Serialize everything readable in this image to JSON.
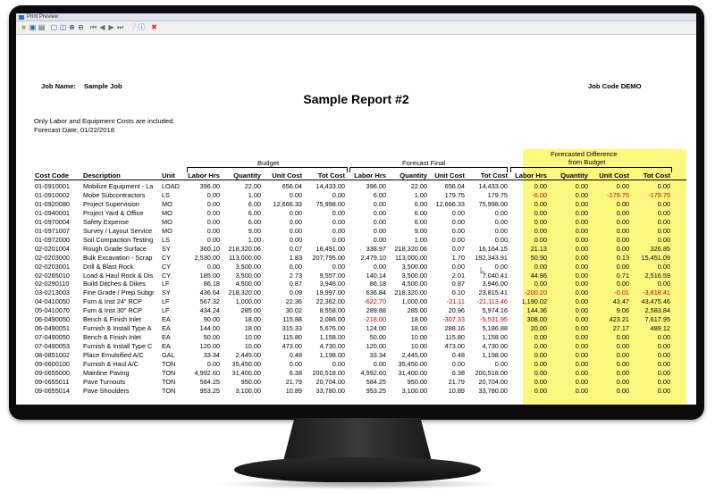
{
  "window": {
    "title": "Print Preview"
  },
  "toolbar": {
    "icons": [
      "open-icon",
      "save-icon",
      "print-icon",
      "page-view-icon",
      "two-page-icon",
      "zoom-in-icon",
      "zoom-out-icon",
      "first-page-icon",
      "prev-page-icon",
      "next-page-icon",
      "last-page-icon",
      "help-icon",
      "info-icon",
      "close-icon"
    ]
  },
  "report": {
    "job_name_label": "Job Name:",
    "job_name": "Sample Job",
    "job_code": "Job Code DEMO",
    "title": "Sample Report #2",
    "note": "Only Labor and Equipment Costs are included.",
    "forecast_date": "Forecast Date: 01/22/2018",
    "group_budget": "Budget",
    "group_forecast": "Forecast Final",
    "group_diff_line1": "Forecasted Difference",
    "group_diff_line2": "from Budget",
    "columns": [
      "Cost Code",
      "Description",
      "Unit",
      "Labor Hrs",
      "Quantity",
      "Unit Cost",
      "Tot Cost",
      "Labor Hrs",
      "Quantity",
      "Unit Cost",
      "Tot Cost",
      "Labor Hrs",
      "Quantity",
      "Unit Cost",
      "Tot Cost"
    ],
    "rows": [
      [
        "01-0910001",
        "Mobilize Equipment - La",
        "LOAD",
        "396.00",
        "22.00",
        "656.04",
        "14,433.00",
        "396.00",
        "22.00",
        "656.04",
        "14,433.00",
        "0.00",
        "0.00",
        "0.00",
        "0.00"
      ],
      [
        "01-0910002",
        "Mobe Subcontractors",
        "LS",
        "0.00",
        "1.00",
        "0.00",
        "0.00",
        "6.00",
        "1.00",
        "179.75",
        "179.75",
        "-6.00",
        "0.00",
        "-179.75",
        "-179.75"
      ],
      [
        "01-0920080",
        "Project Supervision",
        "MO",
        "0.00",
        "6.00",
        "12,666.33",
        "75,998.00",
        "0.00",
        "6.00",
        "12,666.33",
        "75,998.00",
        "0.00",
        "0.00",
        "0.00",
        "0.00"
      ],
      [
        "01-0940001",
        "Project Yard & Office",
        "MO",
        "0.00",
        "6.00",
        "0.00",
        "0.00",
        "0.00",
        "6.00",
        "0.00",
        "0.00",
        "0.00",
        "0.00",
        "0.00",
        "0.00"
      ],
      [
        "01-0970004",
        "Safety Expense",
        "MO",
        "0.00",
        "6.00",
        "0.00",
        "0.00",
        "0.00",
        "6.00",
        "0.00",
        "0.00",
        "0.00",
        "0.00",
        "0.00",
        "0.00"
      ],
      [
        "01-0971007",
        "Survey / Layout Service",
        "MO",
        "0.00",
        "9.00",
        "0.00",
        "0.00",
        "0.00",
        "9.00",
        "0.00",
        "0.00",
        "0.00",
        "0.00",
        "0.00",
        "0.00"
      ],
      [
        "01-0972000",
        "Soil Compaction Testing",
        "LS",
        "0.00",
        "1.00",
        "0.00",
        "0.00",
        "0.00",
        "1.00",
        "0.00",
        "0.00",
        "0.00",
        "0.00",
        "0.00",
        "0.00"
      ],
      [
        "02-0201004",
        "Rough Grade Surface",
        "SY",
        "360.10",
        "218,320.06",
        "0.07",
        "16,491.00",
        "338.97",
        "218,320.06",
        "0.07",
        "16,164.15",
        "21.13",
        "0.00",
        "0.00",
        "326.85"
      ],
      [
        "02-0203000",
        "Bulk Excavation - Scrap",
        "CY",
        "2,530.00",
        "113,000.00",
        "1.83",
        "207,795.00",
        "2,479.10",
        "113,000.00",
        "1.70",
        "192,343.91",
        "50.90",
        "0.00",
        "0.13",
        "15,451.09"
      ],
      [
        "02-0203001",
        "Drill & Blast Rock",
        "CY",
        "0.00",
        "3,500.00",
        "0.00",
        "0.00",
        "0.00",
        "3,500.00",
        "0.00",
        "0.00",
        "0.00",
        "0.00",
        "0.00",
        "0.00"
      ],
      [
        "02-0265010",
        "Load & Haul Rock & Dis",
        "CY",
        "185.00",
        "3,500.00",
        "2.73",
        "9,557.00",
        "140.14",
        "3,500.00",
        "2.01",
        "7,040.41",
        "44.86",
        "0.00",
        "0.71",
        "2,516.59"
      ],
      [
        "02-0290110",
        "Build Ditches & Dikes",
        "LF",
        "86.18",
        "4,500.00",
        "0.87",
        "3,946.00",
        "86.18",
        "4,500.00",
        "0.87",
        "3,946.00",
        "0.00",
        "0.00",
        "0.00",
        "0.00"
      ],
      [
        "03-0213003",
        "Fine Grade / Prep Subgr",
        "SY",
        "436.64",
        "218,320.00",
        "0.09",
        "19,997.00",
        "636.84",
        "218,320.00",
        "0.10",
        "23,815.41",
        "-200.20",
        "0.00",
        "-0.01",
        "-3,818.41"
      ],
      [
        "04-0410050",
        "Furn & Inst 24\" RCP",
        "LF",
        "567.32",
        "1,000.00",
        "22.36",
        "22,362.00",
        "-622.70",
        "1,000.00",
        "-21.11",
        "-21,113.46",
        "1,190.02",
        "0.00",
        "43.47",
        "43,475.46"
      ],
      [
        "05-0410070",
        "Furn & Inst 30\" RCP",
        "LF",
        "434.24",
        "285.00",
        "30.02",
        "8,558.00",
        "289.88",
        "285.00",
        "20.96",
        "5,974.16",
        "144.36",
        "0.00",
        "9.06",
        "2,583.84"
      ],
      [
        "06-0490050",
        "Bench & Finish Inlet",
        "EA",
        "90.00",
        "18.00",
        "115.88",
        "2,086.00",
        "-218.00",
        "18.00",
        "-307.33",
        "-5,531.95",
        "308.00",
        "0.00",
        "423.21",
        "7,617.95"
      ],
      [
        "06-0490051",
        "Furnish & Install Type A",
        "EA",
        "144.00",
        "18.00",
        "315.33",
        "5,676.00",
        "124.00",
        "18.00",
        "288.16",
        "5,186.88",
        "20.00",
        "0.00",
        "27.17",
        "489.12"
      ],
      [
        "07-0490050",
        "Bench & Finish Inlet",
        "EA",
        "50.00",
        "10.00",
        "115.80",
        "1,158.00",
        "50.00",
        "10.00",
        "115.80",
        "1,158.00",
        "0.00",
        "0.00",
        "0.00",
        "0.00"
      ],
      [
        "07-0490053",
        "Furnish & Install Type C",
        "EA",
        "120.00",
        "10.00",
        "473.00",
        "4,730.00",
        "120.00",
        "10.00",
        "473.00",
        "4,730.00",
        "0.00",
        "0.00",
        "0.00",
        "0.00"
      ],
      [
        "08-0851002",
        "Place Emulsified A/C",
        "GAL",
        "33.34",
        "2,445.00",
        "0.48",
        "1,198.00",
        "33.34",
        "2,445.00",
        "0.48",
        "1,198.00",
        "0.00",
        "0.00",
        "0.00",
        "0.00"
      ],
      [
        "09-0600100",
        "Furnish & Haul A/C",
        "TON",
        "0.00",
        "35,450.00",
        "0.00",
        "0.00",
        "0.00",
        "35,450.00",
        "0.00",
        "0.00",
        "0.00",
        "0.00",
        "0.00",
        "0.00"
      ],
      [
        "09-0655000",
        "Mainline Paving",
        "TON",
        "4,992.60",
        "31,400.00",
        "6.38",
        "200,518.00",
        "4,992.60",
        "31,400.00",
        "6.38",
        "200,518.00",
        "0.00",
        "0.00",
        "0.00",
        "0.00"
      ],
      [
        "09-0655011",
        "Pave Turnouts",
        "TON",
        "584.25",
        "950.00",
        "21.79",
        "20,704.00",
        "584.25",
        "950.00",
        "21.79",
        "20,704.00",
        "0.00",
        "0.00",
        "0.00",
        "0.00"
      ],
      [
        "09-0655014",
        "Pave Shoulders",
        "TON",
        "953.25",
        "3,100.00",
        "10.89",
        "33,780.00",
        "953.25",
        "3,100.00",
        "10.89",
        "33,780.00",
        "0.00",
        "0.00",
        "0.00",
        "0.00"
      ]
    ]
  },
  "colors": {
    "highlight": "#fcf77e",
    "negative": "#cc0000"
  }
}
